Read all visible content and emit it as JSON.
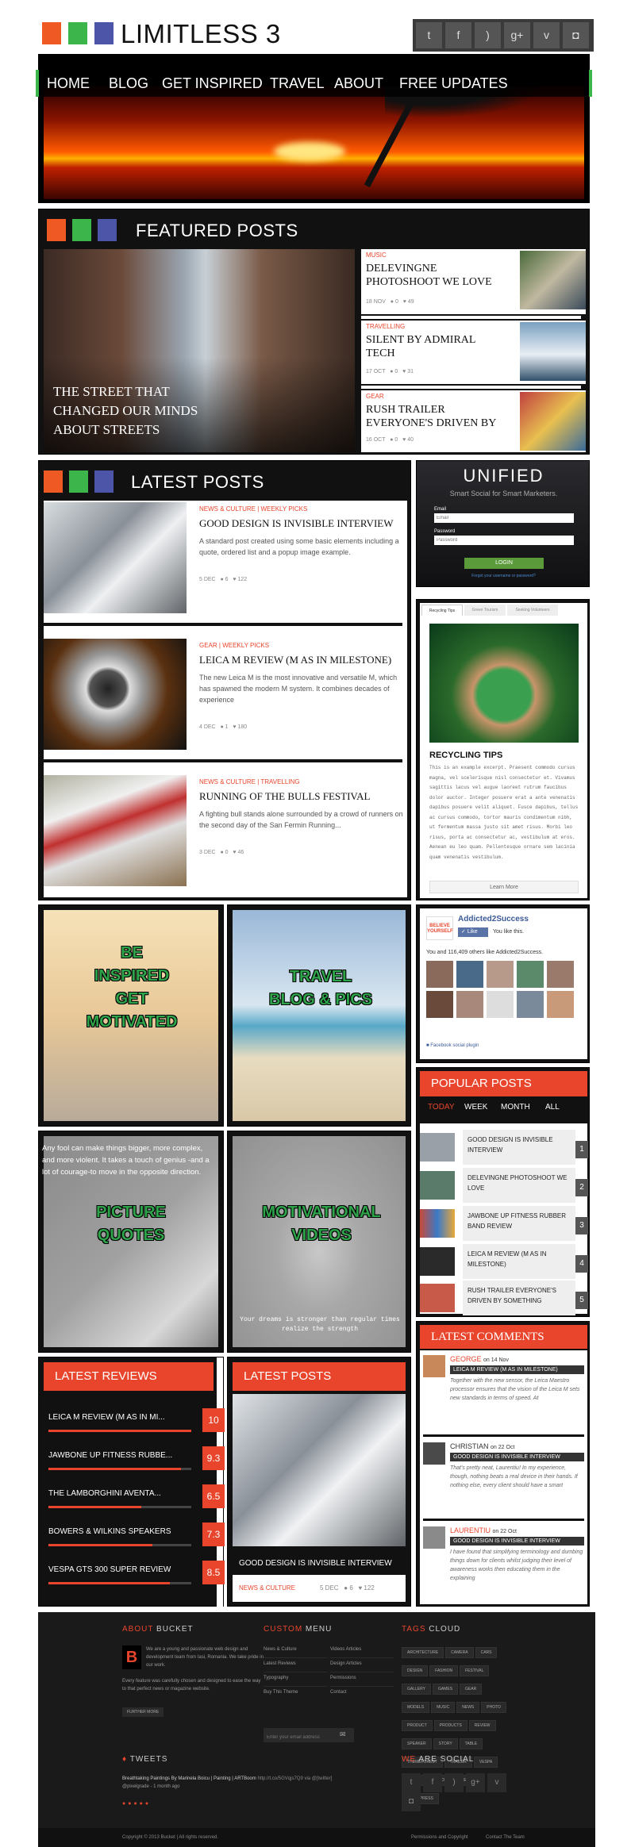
{
  "header": {
    "logo_text": "LIMITLESS 3",
    "social_icons": [
      "twitter-icon",
      "facebook-icon",
      "rss-icon",
      "googleplus-icon",
      "vimeo-icon",
      "instagram-icon"
    ]
  },
  "nav": {
    "items": [
      "HOME",
      "BLOG",
      "GET INSPIRED",
      "TRAVEL",
      "ABOUT",
      "FREE UPDATES"
    ]
  },
  "featured": {
    "title": "FEATURED POSTS",
    "main_caption": "THE STREET THAT CHANGED OUR MINDS ABOUT STREETS",
    "items": [
      {
        "category": "MUSIC",
        "title": "DELEVINGNE PHOTOSHOOT WE LOVE",
        "date": "18 NOV",
        "comments": "0",
        "likes": "49"
      },
      {
        "category": "TRAVELLING",
        "title": "SILENT BY ADMIRAL TECH",
        "date": "17 OCT",
        "comments": "0",
        "likes": "31"
      },
      {
        "category": "GEAR",
        "title": "RUSH TRAILER EVERYONE'S DRIVEN BY",
        "date": "16 OCT",
        "comments": "0",
        "likes": "40"
      }
    ]
  },
  "latest": {
    "title": "LATEST POSTS",
    "posts": [
      {
        "categories": "NEWS & CULTURE | WEEKLY PICKS",
        "title": "GOOD DESIGN IS INVISIBLE INTERVIEW",
        "excerpt": "A standard post created using some basic elements including a quote, ordered list and a popup image example.",
        "date": "5 DEC",
        "comments": "6",
        "likes": "122"
      },
      {
        "categories": "GEAR | WEEKLY PICKS",
        "title": "LEICA M REVIEW (M AS IN MILESTONE)",
        "excerpt": "The new Leica M is the most innovative and versatile M, which has spawned the modern M system. It combines decades of experience",
        "date": "4 DEC",
        "comments": "1",
        "likes": "180"
      },
      {
        "categories": "NEWS & CULTURE | TRAVELLING",
        "title": "RUNNING OF THE BULLS FESTIVAL",
        "excerpt": "A fighting bull stands alone surrounded by a crowd of runners on the second day of the San Fermin Running...",
        "date": "3 DEC",
        "comments": "0",
        "likes": "46"
      }
    ]
  },
  "unified": {
    "title": "UNIFIED",
    "subtitle": "Smart Social for Smart Marketers.",
    "email_label": "Email",
    "email_placeholder": "Email",
    "password_label": "Password",
    "password_placeholder": "Password",
    "login": "LOGIN",
    "forgot": "Forgot your username or password?"
  },
  "tabs_widget": {
    "tabs": [
      "Recycling Tips",
      "Green Tourism",
      "Seeking Volunteers"
    ],
    "heading": "RECYCLING TIPS",
    "body": "This is an example excerpt. Praesent commodo cursus magna, vel scelerisque nisl consectetur et. Vivamus sagittis lacus vel augue laoreet rutrum faucibus dolor auctor. Integer posuere erat a ante venenatis dapibus posuere velit aliquet. Fusce dapibus, tellus ac cursus commodo, tortor mauris condimentum nibh, ut fermentum massa justo sit amet risus. Morbi leo risus, porta ac consectetur ac, vestibulum at eros. Aenean eu leo quam. Pellentesque ornare sem lacinia quam venenatis vestibulum.",
    "button": "Learn More"
  },
  "promos": [
    {
      "text": "BE INSPIRED GET MOTIVATED"
    },
    {
      "text": "TRAVEL BLOG & PICS"
    },
    {
      "text": "PICTURE QUOTES",
      "quote": "Any fool can make things bigger, more complex, and more violent. It takes a touch of genius -and a lot of courage-to move in the opposite direction."
    },
    {
      "text": "MOTIVATIONAL VIDEOS",
      "caption": "Your dreams is stronger than regular times realize the strength"
    }
  ],
  "facebook": {
    "page_name": "Addicted2Success",
    "like_button": "Like",
    "you_like": "You like this.",
    "count_text": "You and 116,409 others like Addicted2Success.",
    "plugin": "Facebook social plugin",
    "logo_text": "BELIEVE YOURSELF"
  },
  "popular": {
    "title": "POPULAR POSTS",
    "tabs": [
      "TODAY",
      "WEEK",
      "MONTH",
      "ALL"
    ],
    "items": [
      {
        "title": "GOOD DESIGN IS INVISIBLE INTERVIEW",
        "num": "1"
      },
      {
        "title": "DELEVINGNE PHOTOSHOOT WE LOVE",
        "num": "2"
      },
      {
        "title": "JAWBONE UP FITNESS RUBBER BAND REVIEW",
        "num": "3"
      },
      {
        "title": "LEICA M REVIEW (M AS IN MILESTONE)",
        "num": "4"
      },
      {
        "title": "RUSH TRAILER EVERYONE'S DRIVEN BY SOMETHING",
        "num": "5"
      }
    ]
  },
  "reviews": {
    "title": "LATEST REVIEWS",
    "items": [
      {
        "name": "LEICA M REVIEW (M AS IN MI...",
        "score": "10",
        "level": 1.0
      },
      {
        "name": "JAWBONE UP FITNESS RUBBE...",
        "score": "9.3",
        "level": 0.93
      },
      {
        "name": "THE LAMBORGHINI AVENTA...",
        "score": "6.5",
        "level": 0.65
      },
      {
        "name": "BOWERS & WILKINS SPEAKERS",
        "score": "7.3",
        "level": 0.73
      },
      {
        "name": "VESPA GTS 300 SUPER REVIEW",
        "score": "8.5",
        "level": 0.85
      }
    ]
  },
  "latest_small": {
    "title": "LATEST POSTS",
    "post_title": "GOOD DESIGN IS INVISIBLE INTERVIEW",
    "category": "NEWS & CULTURE",
    "date": "5 DEC",
    "comments": "6",
    "likes": "122"
  },
  "comments": {
    "title": "LATEST COMMENTS",
    "items": [
      {
        "author": "GEORGE",
        "date": "on 14 Nov",
        "post": "LEICA M REVIEW (M AS IN MILESTONE)",
        "text": "Together with the new sensor, the Leica Maestro processor ensures that the vision of the Leica M sets new standards in terms of speed. At"
      },
      {
        "author": "CHRISTIAN",
        "date": "on 22 Oct",
        "post": "GOOD DESIGN IS INVISIBLE INTERVIEW",
        "text": "That's pretty neat, Laurentiu! In my experience, though, nothing beats a real device in their hands. If nothing else, every client should have a smart"
      },
      {
        "author": "LAURENTIU",
        "date": "on 22 Oct",
        "post": "GOOD DESIGN IS INVISIBLE INTERVIEW",
        "text": "I have found that simplifying terminology and dumbing things down for clients whilst judging their level of awareness works then educating them in the explaining"
      }
    ]
  },
  "footer": {
    "about_title_a": "ABOUT",
    "about_title_b": " BUCKET",
    "about_text": "We are a young and passionate web design and development team from Iasi, Romania. We take pride in our work.",
    "about_text2": "Every feature was carefully chosen and designed to ease the way to that perfect news or magazine website.",
    "further": "FURTHER MORE",
    "menu_title_a": "CUSTOM",
    "menu_title_b": " MENU",
    "menu_col1": [
      "News & Culture",
      "Latest Reviews",
      "Typography",
      "Buy This Theme"
    ],
    "menu_col2": [
      "Videos Articles",
      "Design Articles",
      "Permissions",
      "Contact"
    ],
    "email_placeholder": "Enter your email address",
    "tags_title_a": "TAGS",
    "tags_title_b": " CLOUD",
    "tags": [
      "ARCHITECTURE",
      "CAMERA",
      "CARS",
      "DESIGN",
      "FASHION",
      "FESTIVAL",
      "GALLERY",
      "GAMES",
      "GEAR",
      "MODELS",
      "MUSIC",
      "NEWS",
      "PHOTO",
      "PRODUCT",
      "PRODUCTS",
      "REVIEW",
      "SPEAKER",
      "STORY",
      "TABLE",
      "THEMEFOREST",
      "TRAILER",
      "VESPA",
      "VIDEO",
      "VIDEOS",
      "WEB",
      "WORDPRESS"
    ],
    "tweets_title": "TWEETS",
    "tweet_text": "Breathtaking Paintings By Marinela Boicu | Painting | ARTBoom",
    "tweet_link": "http://t.co/5GVqjs7Q9 via @[twitter]",
    "tweet_meta": "@pixelgrade - 1 month ago",
    "social_title_a": "WE",
    "social_title_b": " ARE SOCIAL",
    "copyright": "Copyright © 2013 Bucket | All rights reserved.",
    "links": [
      "Permissions and Copyright",
      "Contact The Team"
    ]
  }
}
